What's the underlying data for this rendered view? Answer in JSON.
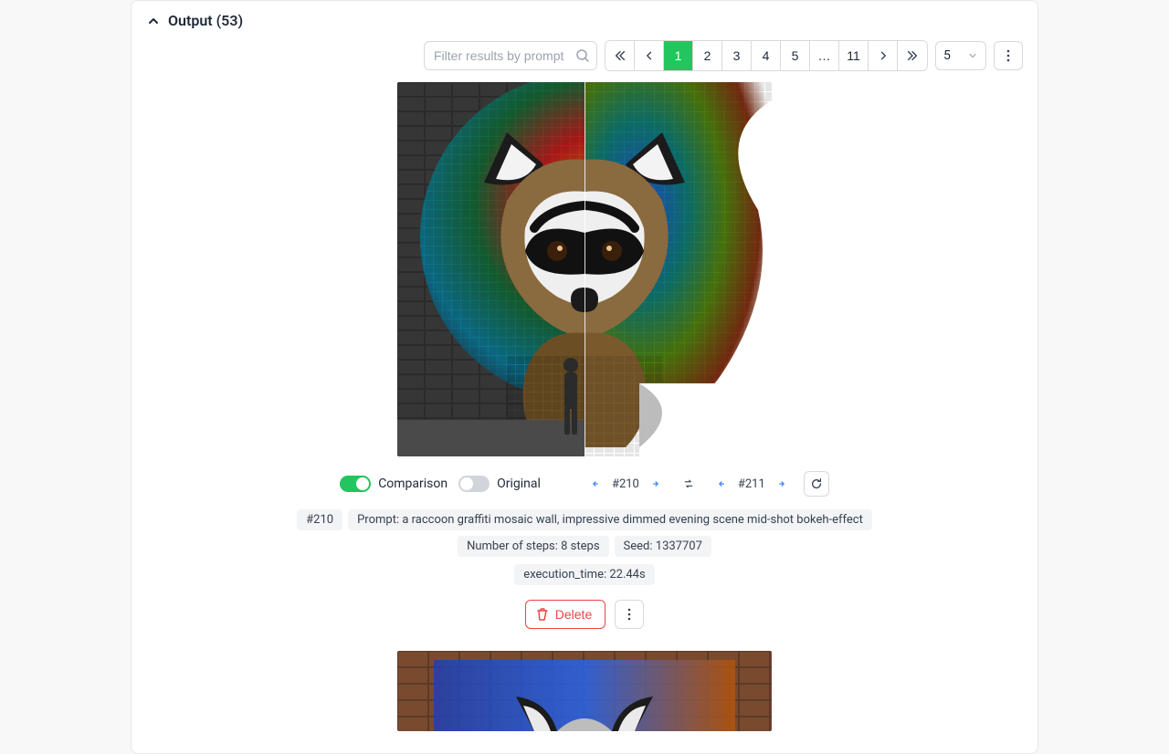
{
  "header": {
    "title": "Output (53)"
  },
  "toolbar": {
    "filter_placeholder": "Filter results by prompt",
    "pages": [
      "1",
      "2",
      "3",
      "4",
      "5",
      "…",
      "11"
    ],
    "active_page_index": 0,
    "page_size": "5"
  },
  "result": {
    "comparison_label": "Comparison",
    "original_label": "Original",
    "comparison_on": true,
    "original_on": false,
    "left_id": "#210",
    "right_id": "#211",
    "meta": {
      "id_chip": "#210",
      "prompt_chip": "Prompt: a raccoon graffiti mosaic wall, impressive dimmed evening scene mid-shot bokeh-effect",
      "steps_chip": "Number of steps: 8 steps",
      "seed_chip": "Seed: 1337707",
      "exec_chip": "execution_time: 22.44s"
    },
    "delete_label": "Delete"
  }
}
